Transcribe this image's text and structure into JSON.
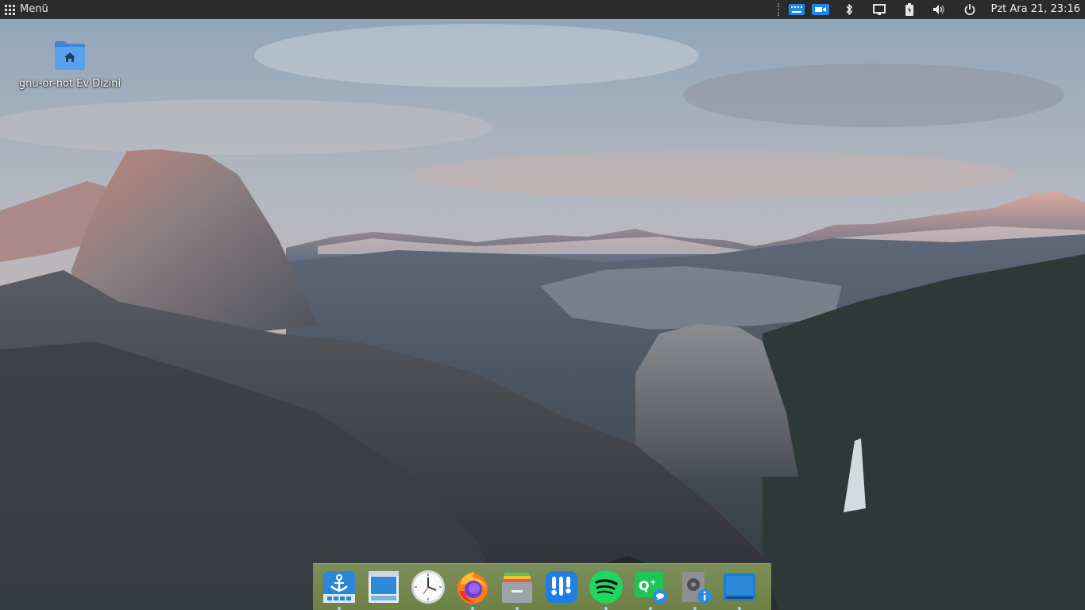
{
  "panel": {
    "menu_label": "Menü",
    "clock": "Pzt Ara 21, 23:16",
    "tray_icons": [
      "keyboard-icon",
      "screen-recorder-icon",
      "bluetooth-icon",
      "display-icon",
      "battery-icon",
      "volume-icon",
      "power-icon"
    ],
    "colors": {
      "panel_bg": "#2b2b2b",
      "accent": "#1e88e5"
    }
  },
  "desktop": {
    "icons": [
      {
        "label": "gnu-or-not Ev Dizini",
        "icon": "home-folder-icon"
      }
    ]
  },
  "dock": {
    "apps": [
      {
        "name": "dock-manager-icon",
        "running": true
      },
      {
        "name": "file-manager-icon",
        "running": false
      },
      {
        "name": "clock-icon",
        "running": false
      },
      {
        "name": "firefox-icon",
        "running": true
      },
      {
        "name": "archive-manager-icon",
        "running": true
      },
      {
        "name": "mixer-icon",
        "running": false
      },
      {
        "name": "spotify-icon",
        "running": true
      },
      {
        "name": "qt-chat-icon",
        "running": true
      },
      {
        "name": "disk-info-icon",
        "running": true
      },
      {
        "name": "desktop-icon",
        "running": true
      }
    ]
  }
}
